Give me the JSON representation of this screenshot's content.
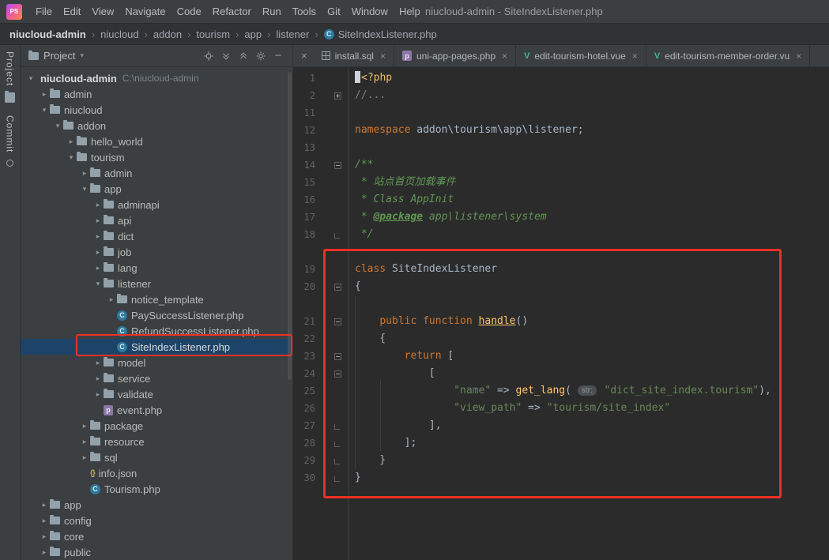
{
  "colors": {
    "chrome-bg": "#3c3f41",
    "editor-bg": "#2b2b2b",
    "breadcrumb-bg": "#303234",
    "selection-bg": "#1d4468",
    "annotation-red": "#ee3124",
    "kw": "#cc7832",
    "str": "#6a8759",
    "doc": "#629755",
    "comment": "#808080",
    "plain": "#a9b7c6",
    "tag": "#e8bf6a",
    "func": "#ffc66b",
    "lineno": "#606366",
    "class-icon": "#2d7a9e",
    "vue-green": "#41b883",
    "folder": "#93a1ab"
  },
  "title_bar": {
    "logo_text": "PS",
    "menus": [
      "File",
      "Edit",
      "View",
      "Navigate",
      "Code",
      "Refactor",
      "Run",
      "Tools",
      "Git",
      "Window",
      "Help"
    ],
    "window_title": "niucloud-admin - SiteIndexListener.php"
  },
  "breadcrumbs": [
    {
      "label": "niucloud-admin",
      "bold": true
    },
    {
      "label": "niucloud"
    },
    {
      "label": "addon"
    },
    {
      "label": "tourism"
    },
    {
      "label": "app"
    },
    {
      "label": "listener"
    },
    {
      "label": "SiteIndexListener.php",
      "icon": "class"
    }
  ],
  "tool_strip": {
    "project_label": "Project",
    "commit_label": "Commit"
  },
  "project_panel": {
    "header": {
      "title": "Project"
    },
    "tree": [
      {
        "label": "niucloud-admin",
        "suffix": "C:\\niucloud-admin",
        "kind": "root",
        "level": 0,
        "state": "expanded"
      },
      {
        "label": "admin",
        "kind": "folder",
        "level": 1,
        "state": "collapsed"
      },
      {
        "label": "niucloud",
        "kind": "folder",
        "level": 1,
        "state": "expanded"
      },
      {
        "label": "addon",
        "kind": "folder",
        "level": 2,
        "state": "expanded"
      },
      {
        "label": "hello_world",
        "kind": "folder",
        "level": 3,
        "state": "collapsed"
      },
      {
        "label": "tourism",
        "kind": "folder",
        "level": 3,
        "state": "expanded"
      },
      {
        "label": "admin",
        "kind": "folder",
        "level": 4,
        "state": "collapsed"
      },
      {
        "label": "app",
        "kind": "folder",
        "level": 4,
        "state": "expanded"
      },
      {
        "label": "adminapi",
        "kind": "folder",
        "level": 5,
        "state": "collapsed"
      },
      {
        "label": "api",
        "kind": "folder",
        "level": 5,
        "state": "collapsed"
      },
      {
        "label": "dict",
        "kind": "folder",
        "level": 5,
        "state": "collapsed"
      },
      {
        "label": "job",
        "kind": "folder",
        "level": 5,
        "state": "collapsed"
      },
      {
        "label": "lang",
        "kind": "folder",
        "level": 5,
        "state": "collapsed"
      },
      {
        "label": "listener",
        "kind": "folder",
        "level": 5,
        "state": "expanded"
      },
      {
        "label": "notice_template",
        "kind": "folder",
        "level": 6,
        "state": "collapsed"
      },
      {
        "label": "PaySuccessListener.php",
        "kind": "class",
        "level": 6
      },
      {
        "label": "RefundSuccessListener.php",
        "kind": "class",
        "level": 6
      },
      {
        "label": "SiteIndexListener.php",
        "kind": "class",
        "level": 6,
        "selected": true
      },
      {
        "label": "model",
        "kind": "folder",
        "level": 5,
        "state": "collapsed"
      },
      {
        "label": "service",
        "kind": "folder",
        "level": 5,
        "state": "collapsed"
      },
      {
        "label": "validate",
        "kind": "folder",
        "level": 5,
        "state": "collapsed"
      },
      {
        "label": "event.php",
        "kind": "php",
        "level": 5
      },
      {
        "label": "package",
        "kind": "folder",
        "level": 4,
        "state": "collapsed"
      },
      {
        "label": "resource",
        "kind": "folder",
        "level": 4,
        "state": "collapsed"
      },
      {
        "label": "sql",
        "kind": "folder",
        "level": 4,
        "state": "collapsed"
      },
      {
        "label": "info.json",
        "kind": "json",
        "level": 4
      },
      {
        "label": "Tourism.php",
        "kind": "class",
        "level": 4
      },
      {
        "label": "app",
        "kind": "folder",
        "level": 1,
        "state": "collapsed"
      },
      {
        "label": "config",
        "kind": "folder",
        "level": 1,
        "state": "collapsed"
      },
      {
        "label": "core",
        "kind": "folder",
        "level": 1,
        "state": "collapsed"
      },
      {
        "label": "public",
        "kind": "folder",
        "level": 1,
        "state": "collapsed"
      }
    ]
  },
  "editor": {
    "tabs": [
      {
        "label": "install.sql",
        "icon": "sql"
      },
      {
        "label": "uni-app-pages.php",
        "icon": "php"
      },
      {
        "label": "edit-tourism-hotel.vue",
        "icon": "vue"
      },
      {
        "label": "edit-tourism-member-order.vu",
        "icon": "vue"
      }
    ],
    "lines": [
      {
        "n": "1",
        "caret": true,
        "seg": [
          {
            "t": "<?php",
            "c": "tag"
          }
        ]
      },
      {
        "n": "2",
        "fold": "plus",
        "seg": [
          {
            "t": "//...",
            "c": "comment"
          }
        ]
      },
      {
        "n": "11",
        "seg": []
      },
      {
        "n": "12",
        "seg": [
          {
            "t": "namespace ",
            "c": "kw"
          },
          {
            "t": "addon\\tourism\\app\\listener;",
            "c": "plain"
          }
        ]
      },
      {
        "n": "13",
        "seg": []
      },
      {
        "n": "14",
        "fold": "minus",
        "seg": [
          {
            "t": "/**",
            "c": "doc"
          }
        ]
      },
      {
        "n": "15",
        "seg": [
          {
            "t": " * 站点首页加载事件",
            "c": "doc"
          }
        ]
      },
      {
        "n": "16",
        "seg": [
          {
            "t": " * Class AppInit",
            "c": "doc"
          }
        ]
      },
      {
        "n": "17",
        "seg": [
          {
            "t": " * ",
            "c": "doc"
          },
          {
            "t": "@package",
            "c": "doctag"
          },
          {
            "t": " app\\listener\\system",
            "c": "doc"
          }
        ]
      },
      {
        "n": "18",
        "fold": "end",
        "seg": [
          {
            "t": " */",
            "c": "doc"
          }
        ]
      },
      {
        "n": "19",
        "gap": true,
        "seg": [
          {
            "t": "class ",
            "c": "kw"
          },
          {
            "t": "SiteIndexListener",
            "c": "plain"
          }
        ]
      },
      {
        "n": "20",
        "fold": "minus",
        "seg": [
          {
            "t": "{",
            "c": "plain"
          }
        ]
      },
      {
        "n": "21",
        "gap": true,
        "fold": "minus",
        "seg": [
          {
            "t": "    ",
            "c": "plain"
          },
          {
            "t": "public function ",
            "c": "kw"
          },
          {
            "t": "handle",
            "c": "func"
          },
          {
            "t": "()",
            "c": "plain"
          }
        ]
      },
      {
        "n": "22",
        "seg": [
          {
            "t": "    {",
            "c": "plain"
          }
        ]
      },
      {
        "n": "23",
        "fold": "minus",
        "seg": [
          {
            "t": "        ",
            "c": "plain"
          },
          {
            "t": "return",
            "c": "kw"
          },
          {
            "t": " [",
            "c": "plain"
          }
        ]
      },
      {
        "n": "24",
        "fold": "minus",
        "seg": [
          {
            "t": "            [",
            "c": "plain"
          }
        ]
      },
      {
        "n": "25",
        "seg": [
          {
            "t": "                ",
            "c": "plain"
          },
          {
            "t": "\"name\"",
            "c": "str"
          },
          {
            "t": " => ",
            "c": "plain"
          },
          {
            "t": "get_lang",
            "c": "call"
          },
          {
            "t": "( ",
            "c": "plain"
          },
          {
            "t": "str:",
            "c": "pill"
          },
          {
            "t": " ",
            "c": "plain"
          },
          {
            "t": "\"dict_site_index.tourism\"",
            "c": "str"
          },
          {
            "t": "),",
            "c": "plain"
          }
        ]
      },
      {
        "n": "26",
        "seg": [
          {
            "t": "                ",
            "c": "plain"
          },
          {
            "t": "\"view_path\"",
            "c": "str"
          },
          {
            "t": " => ",
            "c": "plain"
          },
          {
            "t": "\"tourism/site_index\"",
            "c": "str"
          }
        ]
      },
      {
        "n": "27",
        "fold": "end",
        "seg": [
          {
            "t": "            ],",
            "c": "plain"
          }
        ]
      },
      {
        "n": "28",
        "fold": "end",
        "seg": [
          {
            "t": "        ];",
            "c": "plain"
          }
        ]
      },
      {
        "n": "29",
        "fold": "end",
        "seg": [
          {
            "t": "    }",
            "c": "plain"
          }
        ]
      },
      {
        "n": "30",
        "fold": "end",
        "seg": [
          {
            "t": "}",
            "c": "plain"
          }
        ]
      }
    ]
  }
}
